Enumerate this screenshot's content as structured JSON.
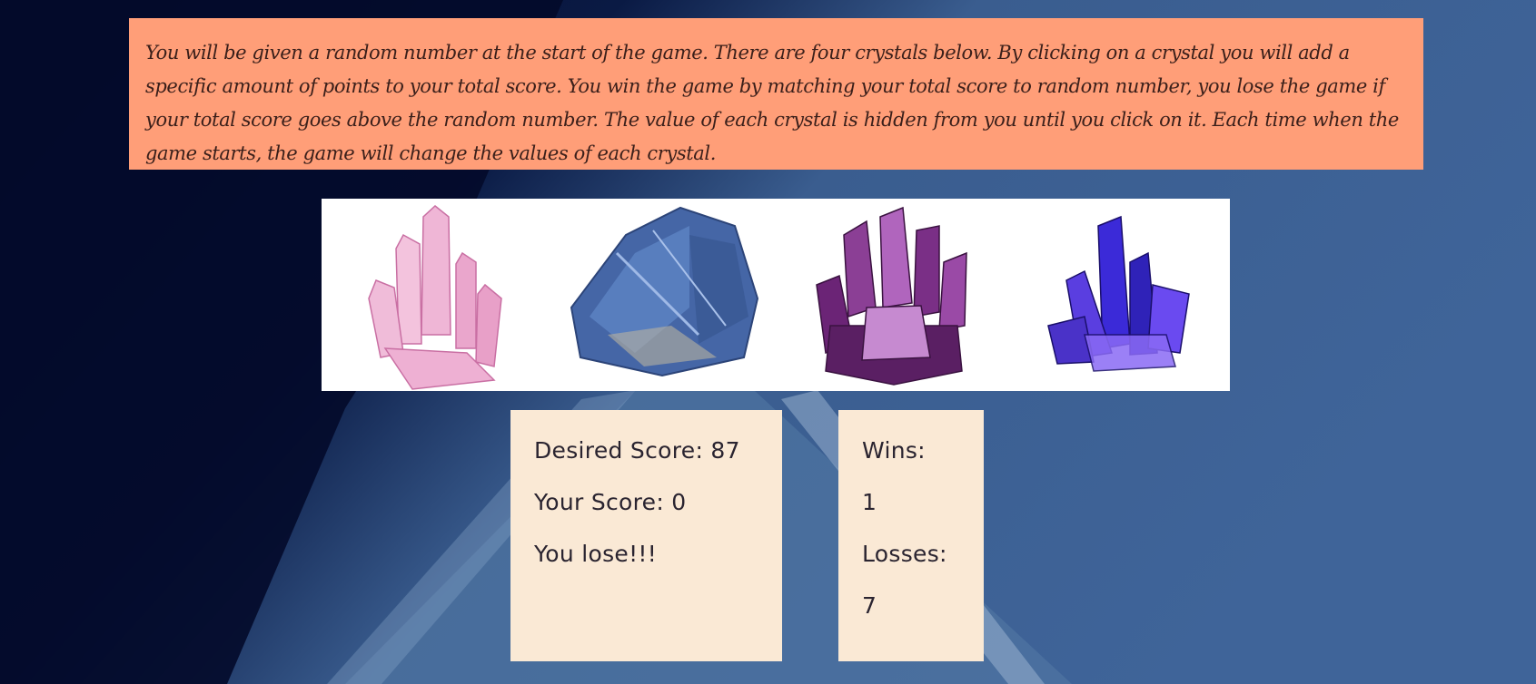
{
  "instructions": {
    "text": "You will be given a random number at the start of the game. There are four crystals below. By clicking on a crystal you will add a specific amount of points to your total score. You win the game by matching your total score to random number, you lose the game if your total score goes above the random number. The value of each crystal is hidden from you until you click on it. Each time when the game starts, the game will change the values of each crystal."
  },
  "crystals": [
    {
      "name": "pink-crystal-icon",
      "color": "#e9a3c9"
    },
    {
      "name": "blue-kyanite-crystal-icon",
      "color": "#3f64a8"
    },
    {
      "name": "purple-amethyst-crystal-icon",
      "color": "#6a2b74"
    },
    {
      "name": "violet-blue-crystal-icon",
      "color": "#3a2ad0"
    }
  ],
  "score": {
    "desired_label": "Desired Score: 87",
    "your_label": "Your Score: 0",
    "status": "You lose!!!"
  },
  "tally": {
    "wins_label": "Wins:",
    "wins": "1",
    "losses_label": "Losses:",
    "losses": "7"
  },
  "colors": {
    "instructions_bg": "#ff9e78",
    "panel_bg": "#fae9d5",
    "page_bg_dark": "#030a2a",
    "page_bg_blue": "#3a5d8f"
  }
}
